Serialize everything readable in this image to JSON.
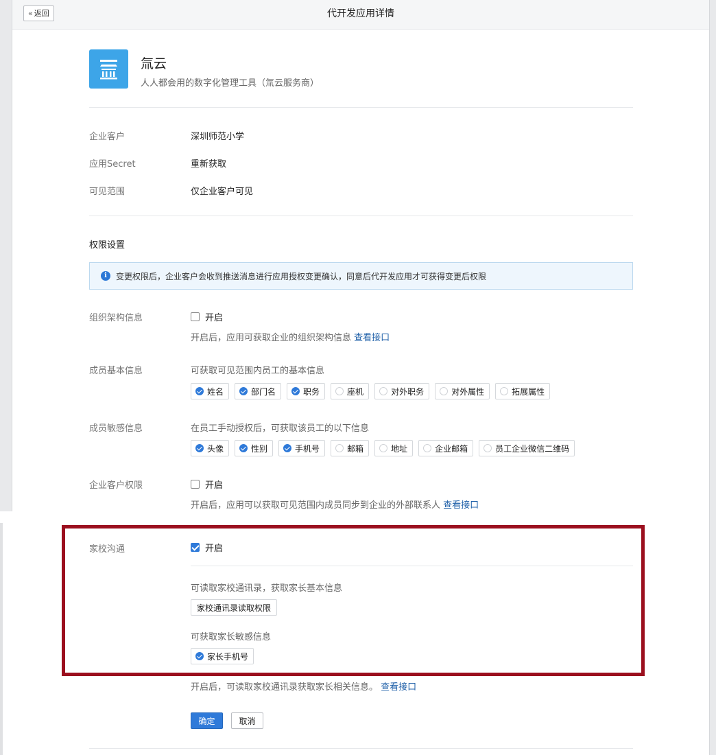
{
  "header": {
    "back_label": "返回",
    "title": "代开发应用详情"
  },
  "app": {
    "name": "氚云",
    "description": "人人都会用的数字化管理工具（氚云服务商）",
    "logo_color": "#3da5e8"
  },
  "info": {
    "customer_label": "企业客户",
    "customer_value": "深圳师范小学",
    "secret_label": "应用Secret",
    "secret_link": "重新获取",
    "scope_label": "可见范围",
    "scope_value": "仅企业客户可见"
  },
  "permissions": {
    "title": "权限设置",
    "notice": "变更权限后，企业客户会收到推送消息进行应用授权变更确认，同意后代开发应用才可获得变更后权限",
    "org": {
      "label": "组织架构信息",
      "toggle": "开启",
      "desc": "开启后，应用可获取企业的组织架构信息",
      "link": "查看接口"
    },
    "member_basic": {
      "label": "成员基本信息",
      "desc": "可获取可见范围内员工的基本信息",
      "tags": [
        "姓名",
        "部门名",
        "职务",
        "座机",
        "对外职务",
        "对外属性",
        "拓展属性"
      ],
      "checked": [
        true,
        true,
        true,
        false,
        false,
        false,
        false
      ]
    },
    "member_sensitive": {
      "label": "成员敏感信息",
      "desc": "在员工手动授权后，可获取该员工的以下信息",
      "tags": [
        "头像",
        "性别",
        "手机号",
        "邮箱",
        "地址",
        "企业邮箱",
        "员工企业微信二维码"
      ],
      "checked": [
        true,
        true,
        true,
        false,
        false,
        false,
        false
      ]
    },
    "customer_perm": {
      "label": "企业客户权限",
      "toggle": "开启",
      "desc": "开启后，应用可以获取可见范围内成员同步到企业的外部联系人",
      "link": "查看接口"
    },
    "home_school": {
      "label": "家校沟通",
      "toggle": "开启",
      "contacts_desc": "可读取家校通讯录，获取家长基本信息",
      "contacts_tag": "家校通讯录读取权限",
      "sensitive_desc": "可获取家长敏感信息",
      "sensitive_tag": "家长手机号",
      "footer_desc": "开启后，可读取家校通讯录获取家长相关信息。",
      "link": "查看接口"
    }
  },
  "actions": {
    "confirm": "确定",
    "cancel": "取消"
  },
  "colors": {
    "accent": "#2f7ad9",
    "link": "#1e5fa8",
    "highlight": "#9b0f1e"
  }
}
